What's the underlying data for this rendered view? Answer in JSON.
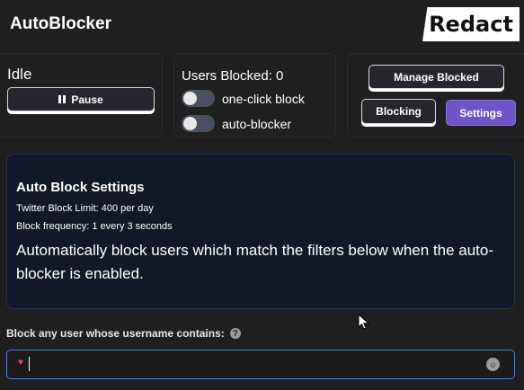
{
  "app": {
    "title": "AutoBlocker",
    "logo_text": "Redact"
  },
  "status": {
    "text": "Idle",
    "pause_label": "Pause"
  },
  "users": {
    "blocked_label": "Users Blocked: 0",
    "one_click_label": "one-click block",
    "auto_blocker_label": "auto-blocker",
    "one_click_on": false,
    "auto_blocker_on": false
  },
  "nav": {
    "manage_label": "Manage Blocked",
    "blocking_label": "Blocking",
    "settings_label": "Settings"
  },
  "settings": {
    "title": "Auto Block Settings",
    "limit": "Twitter Block Limit: 400 per day",
    "frequency": "Block frequency: 1 every 3 seconds",
    "description": "Automatically block users which match the filters below when the auto-blocker is enabled."
  },
  "filter": {
    "label": "Block any user whose username contains:",
    "value": ""
  },
  "colors": {
    "accent": "#6e54c8",
    "panel_bg": "#111827",
    "focus_border": "#4c80d8"
  },
  "icons": [
    "pause-icon",
    "help-icon",
    "heart-icon",
    "emoji-icon",
    "mouse-cursor-icon"
  ]
}
